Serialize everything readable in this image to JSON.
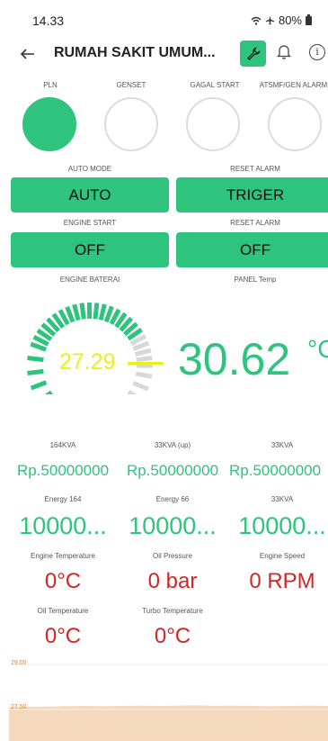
{
  "status_bar": {
    "time": "14.33",
    "battery": "80%"
  },
  "app_bar": {
    "title": "RUMAH SAKIT UMUM..."
  },
  "indicators": [
    {
      "label": "PLN",
      "on": true
    },
    {
      "label": "GENSET",
      "on": false
    },
    {
      "label": "GAGAL START",
      "on": false
    },
    {
      "label": "ATSMF/GEN ALARM",
      "on": false
    }
  ],
  "controls": {
    "auto_mode": {
      "label": "AUTO MODE",
      "button": "AUTO"
    },
    "reset_alarm_1": {
      "label": "RESET ALARM",
      "button": "TRIGER"
    },
    "engine_start": {
      "label": "ENGINE START",
      "button": "OFF"
    },
    "reset_alarm_2": {
      "label": "RESET ALARM",
      "button": "OFF"
    }
  },
  "battery_gauge": {
    "label": "ENGINE BATERAI",
    "value": "27.29",
    "level": 0.8
  },
  "panel_temp": {
    "label": "PANEL Temp",
    "value": "30.62",
    "unit": "°C"
  },
  "tariffs": [
    {
      "label": "164KVA",
      "value": "Rp.50000000"
    },
    {
      "label": "33KVA (up)",
      "value": "Rp.50000000"
    },
    {
      "label": "33KVA",
      "value": "Rp.50000000"
    }
  ],
  "energies": [
    {
      "label": "Energy 164",
      "value": "10000..."
    },
    {
      "label": "Energy 66",
      "value": "10000..."
    },
    {
      "label": "33KVA",
      "value": "10000..."
    }
  ],
  "engine_metrics": [
    {
      "label": "Engine Temperature",
      "value": "0°C"
    },
    {
      "label": "Oil Pressure",
      "value": "0 bar"
    },
    {
      "label": "Engine Speed",
      "value": "0 RPM"
    }
  ],
  "extra_metrics": [
    {
      "label": "Oil Temperature",
      "value": "0°C"
    },
    {
      "label": "Turbo Temperature",
      "value": "0°C"
    }
  ],
  "chart_data": {
    "type": "area",
    "y_ticks": [
      "29.00",
      "27.50"
    ],
    "ylim": [
      27.5,
      29.0
    ],
    "values": [
      27.58,
      27.59,
      27.6,
      27.61,
      27.62,
      27.61,
      27.62,
      27.63,
      27.62,
      27.63,
      27.64,
      27.62,
      27.63,
      27.62,
      27.61,
      27.62,
      27.63,
      27.62
    ],
    "color": "#f5d9bd"
  },
  "colors": {
    "accent": "#2ec47e",
    "alert": "#d42525",
    "gauge": "#e8f01e"
  }
}
